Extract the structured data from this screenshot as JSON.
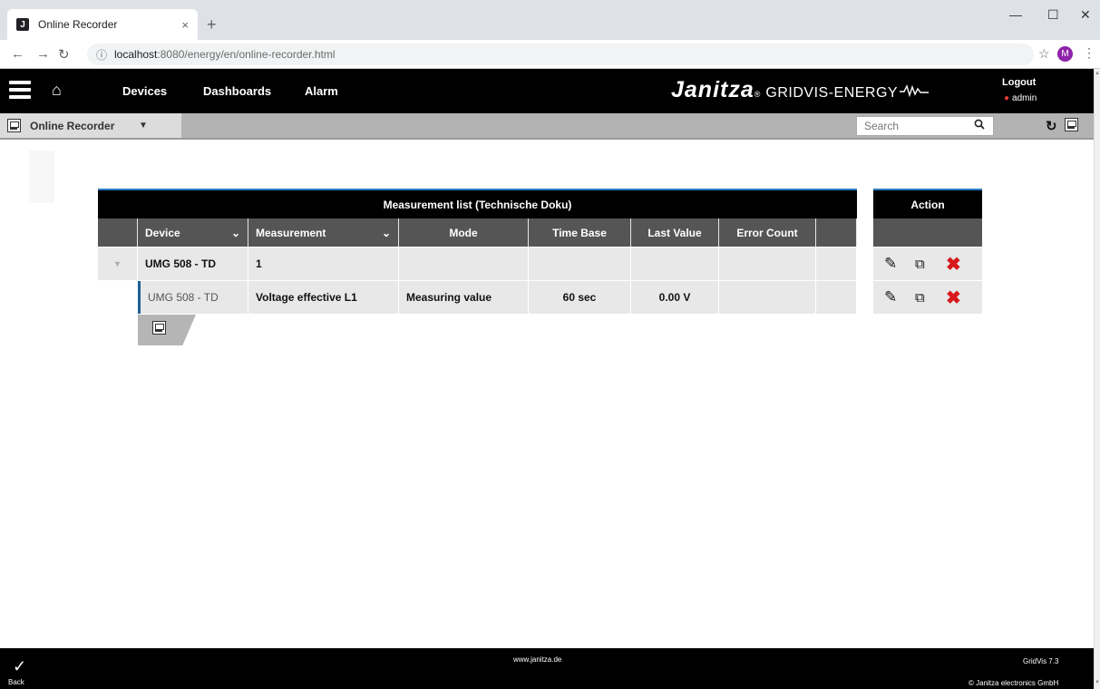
{
  "browser": {
    "tab_title": "Online Recorder",
    "tab_favicon": "J",
    "tab_close": "×",
    "new_tab": "+",
    "url_host": "localhost",
    "url_path": ":8080/energy/en/online-recorder.html",
    "profile_initial": "M",
    "icons": [
      "back-arrow-icon",
      "forward-arrow-icon",
      "reload-icon",
      "info-icon",
      "star-icon",
      "kebab-menu-icon",
      "minimize-icon",
      "maximize-icon",
      "close-window-icon"
    ]
  },
  "header": {
    "nav": [
      "Devices",
      "Dashboards",
      "Alarm"
    ],
    "brand": "Janitza",
    "brand_reg": "®",
    "product": "GRIDVIS-ENERGY",
    "logout": "Logout",
    "user": "admin"
  },
  "toolbar": {
    "title": "Online Recorder",
    "search_placeholder": "Search"
  },
  "table": {
    "title": "Measurement list (Technische Doku)",
    "columns": [
      "Device",
      "Measurement",
      "Mode",
      "Time Base",
      "Last Value",
      "Error Count"
    ],
    "group_row": {
      "device": "UMG 508 - TD",
      "measurement": "1"
    },
    "rows": [
      {
        "device": "UMG 508 - TD",
        "measurement": "Voltage effective L1",
        "mode": "Measuring value",
        "time_base": "60 sec",
        "last_value": "0.00 V",
        "error_count": ""
      }
    ]
  },
  "action": {
    "title": "Action"
  },
  "footer": {
    "back": "Back",
    "site": "www.janitza.de",
    "version": "GridVis 7.3",
    "copyright": "© Janitza electronics GmbH"
  },
  "colors": {
    "accent": "#2d7bbf",
    "delete": "#d7191c",
    "header_bg": "#000000"
  }
}
